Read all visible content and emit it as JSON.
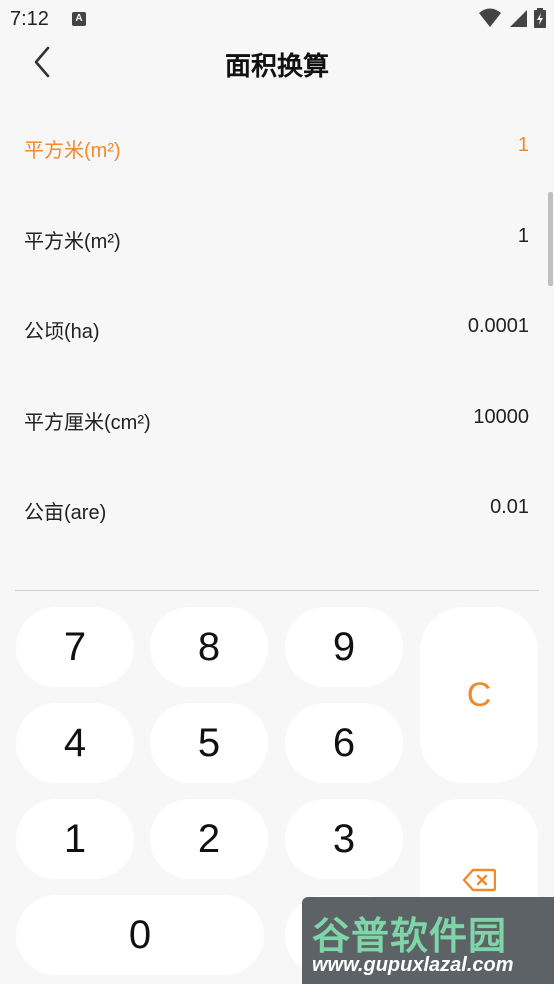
{
  "status_bar": {
    "time": "7:12",
    "app_badge": "A"
  },
  "header": {
    "title": "面积换算"
  },
  "units": [
    {
      "label": "平方米(m²)",
      "value": "1",
      "active": true
    },
    {
      "label": "平方米(m²)",
      "value": "1",
      "active": false
    },
    {
      "label": "公顷(ha)",
      "value": "0.0001",
      "active": false
    },
    {
      "label": "平方厘米(cm²)",
      "value": "10000",
      "active": false
    },
    {
      "label": "公亩(are)",
      "value": "0.01",
      "active": false
    }
  ],
  "keypad": {
    "k7": "7",
    "k8": "8",
    "k9": "9",
    "k4": "4",
    "k5": "5",
    "k6": "6",
    "k1": "1",
    "k2": "2",
    "k3": "3",
    "k0": "0",
    "clear": "C"
  },
  "watermark": {
    "title": "谷普软件园",
    "url": "www.gupuxlazal.com"
  },
  "colors": {
    "accent": "#f08a2c",
    "background": "#f7f7f7",
    "key_background": "#ffffff"
  },
  "icons": {
    "back": "chevron-left-icon",
    "backspace": "backspace-icon",
    "wifi": "wifi-icon",
    "signal": "signal-icon",
    "battery": "battery-icon"
  }
}
